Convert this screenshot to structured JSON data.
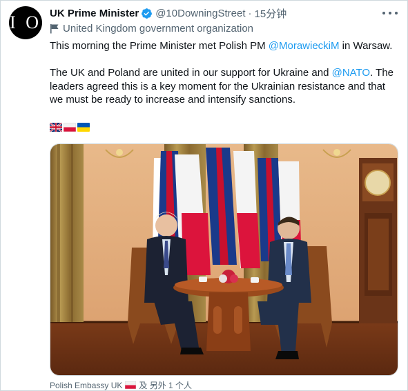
{
  "tweet": {
    "display_name": "UK Prime Minister",
    "handle": "@10DowningStreet",
    "separator": "·",
    "time": "15分钟",
    "org_label": "United Kingdom government organization",
    "avatar_text": "I O",
    "line1_pre": "This morning the Prime Minister met Polish PM ",
    "line1_mention": "@MorawieckiM",
    "line1_post": " in Warsaw.",
    "para2_pre": "The UK and Poland are united in our support for Ukraine and ",
    "para2_mention": "@NATO",
    "para2_post": ". The leaders agreed this is a key moment for the Ukrainian resistance and that we must be ready to increase and intensify sanctions.",
    "flags": [
      "uk-flag",
      "poland-flag",
      "ukraine-flag"
    ]
  },
  "tags": {
    "account": "Polish Embassy UK",
    "others": "及 另外 1 个人"
  },
  "colors": {
    "accent": "#1d9bf0",
    "secondary_text": "#536471",
    "border": "#cfd9de"
  }
}
